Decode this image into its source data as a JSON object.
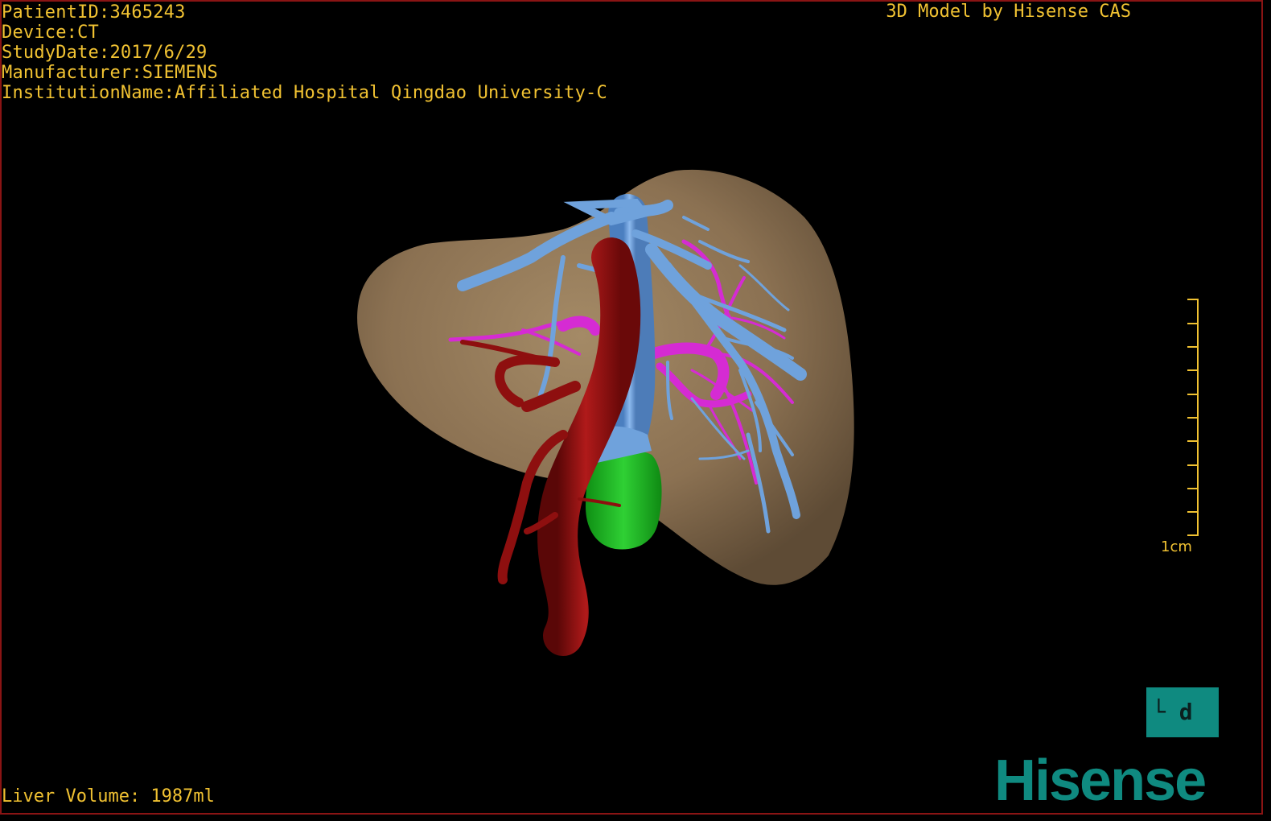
{
  "overlay": {
    "patient_id": "PatientID:3465243",
    "device": "Device:CT",
    "study_date": "StudyDate:2017/6/29",
    "manufacturer": "Manufacturer:SIEMENS",
    "institution": "InstitutionName:Affiliated Hospital Qingdao University-C",
    "credit": "3D Model by Hisense CAS",
    "liver_volume": "Liver Volume: 1987ml"
  },
  "scale": {
    "label": "1cm"
  },
  "orientation": {
    "text": "└ d"
  },
  "brand": {
    "logo_text": "Hisense"
  },
  "colors": {
    "overlay_text": "#f1c232",
    "liver": "#8b7152",
    "artery": "#9a0f0f",
    "portal_vein": "#6fa2dc",
    "hepatic_vein": "#d52bd3",
    "tumor": "#1fb824",
    "brand": "#0f8a80",
    "border": "#8a1414"
  }
}
